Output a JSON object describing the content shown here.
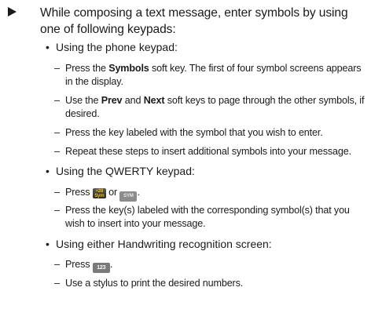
{
  "step": {
    "text": "While composing a text message, enter symbols by using one of following keypads:"
  },
  "phone_keypad": {
    "heading": "Using the phone keypad:",
    "items": [
      {
        "pre": "Press the ",
        "bold": "Symbols",
        "post": " soft key. The first of four symbol screens appears in the display."
      },
      {
        "pre": "Use the ",
        "bold": "Prev",
        "mid": " and ",
        "bold2": "Next",
        "post": " soft keys to page through the other symbols, if desired."
      },
      {
        "text": "Press the key labeled with the symbol that you wish to enter."
      },
      {
        "text": "Repeat these steps to insert additional symbols into your message."
      }
    ]
  },
  "qwerty_keypad": {
    "heading": "Using the QWERTY keypad:",
    "press_label": "Press",
    "or_label": "or",
    "end_punct": ".",
    "item2": "Press the key(s) labeled with the corresponding symbol(s) that you wish to insert into your message."
  },
  "handwriting": {
    "heading": "Using either Handwriting recognition screen:",
    "press_label": "Press",
    "end_punct": ".",
    "item2": "Use a stylus to print the desired numbers."
  },
  "keys": {
    "sym_key_top": "+28",
    "sym_key_bottom": "Sym",
    "sym_key_alt": "SYM",
    "num_key": "123"
  },
  "bullet_char": "•",
  "dash_char": "–",
  "colors": {
    "text": "#1a1a1a",
    "sym_key_text": "#f2c200",
    "key_gray": "#8c8c8c"
  }
}
